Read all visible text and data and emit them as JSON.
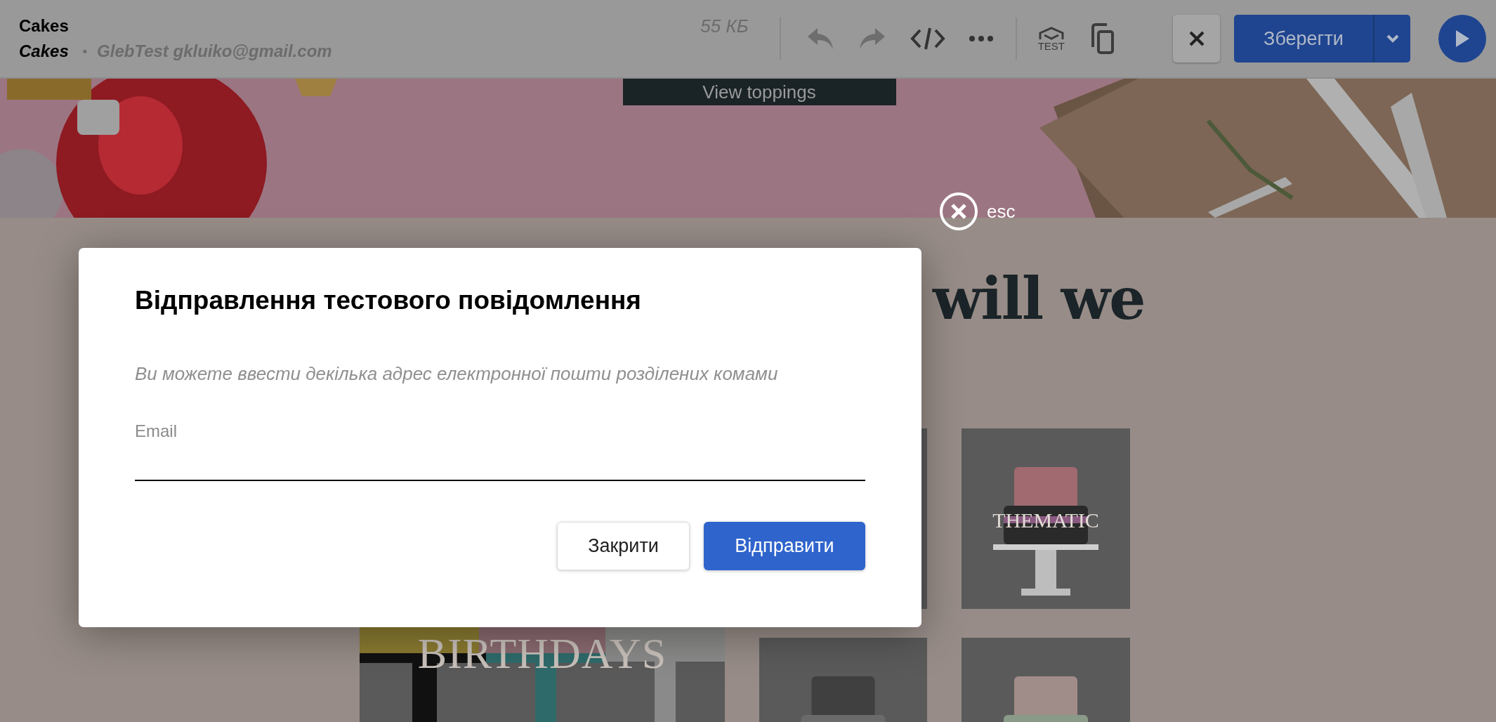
{
  "toolbar": {
    "title": "Cakes",
    "template_name": "Cakes",
    "separator": "•",
    "account": "GlebTest gkluiko@gmail.com",
    "size": "55 КБ",
    "test_label": "TEST",
    "save_button": "Зберегти"
  },
  "page": {
    "banner": {
      "kind": "picture",
      "button": "View toppings"
    },
    "heading": "will we",
    "tiles": [
      {
        "kind": "large",
        "label": "BIRTHDAYS"
      },
      {
        "kind": "small"
      },
      {
        "kind": "small",
        "label": "THEMATIC"
      },
      {
        "kind": "small"
      },
      {
        "kind": "small"
      }
    ]
  },
  "close_overlay": {
    "label": "esc"
  },
  "dialog": {
    "title": "Відправлення тестового повідомлення",
    "hint": "Ви можете ввести декілька адрес електронної пошти розділених комами",
    "field": {
      "label": "Email"
    },
    "buttons": [
      {
        "label": "Закрити",
        "kind": "secondary"
      },
      {
        "label": "Відправити",
        "kind": "primary"
      }
    ]
  }
}
